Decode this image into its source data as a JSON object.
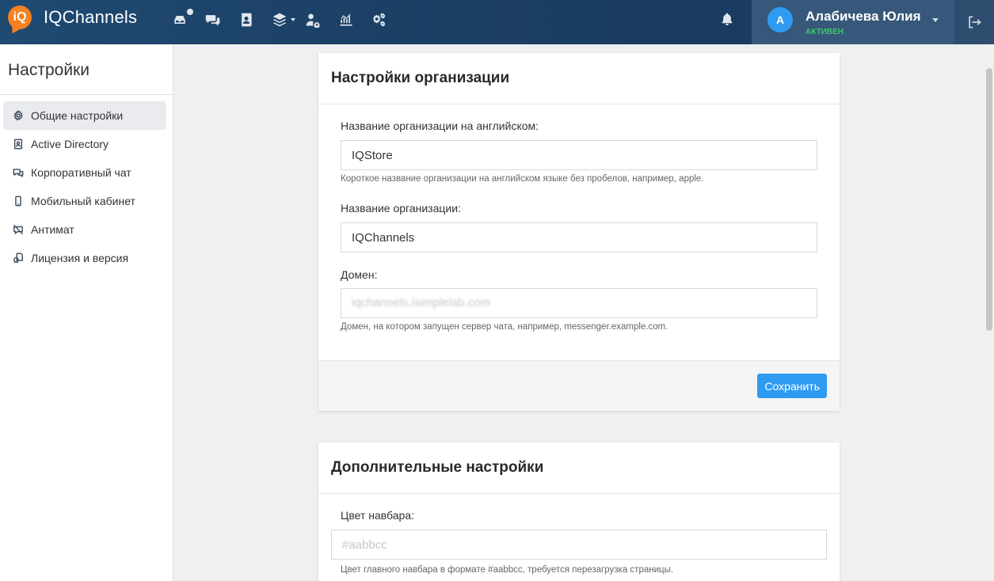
{
  "app": {
    "brand_logo": "iQ",
    "brand_name": "IQChannels"
  },
  "navbar": {
    "icons": [
      "inbox-icon",
      "chats-icon",
      "contacts-icon",
      "layers-icon",
      "users-settings-icon",
      "analytics-icon",
      "settings-icon"
    ],
    "bell_icon": "bell-icon",
    "user": {
      "avatar_initial": "А",
      "name": "Алабичева Юлия",
      "status": "АКТИВЕН"
    },
    "logout_icon": "logout-icon"
  },
  "colors": {
    "navbar": "#1f4a72",
    "user_panel": "#37587a",
    "accent": "#2e9bf2",
    "status_active": "#3ec66b",
    "brand_orange": "#f58220"
  },
  "sidebar": {
    "title": "Настройки",
    "items": [
      {
        "label": "Общие настройки",
        "icon": "gear-icon",
        "active": true
      },
      {
        "label": "Active Directory",
        "icon": "address-book-icon",
        "active": false
      },
      {
        "label": "Корпоративный чат",
        "icon": "chat-bubbles-icon",
        "active": false
      },
      {
        "label": "Мобильный кабинет",
        "icon": "mobile-icon",
        "active": false
      },
      {
        "label": "Антимат",
        "icon": "muted-comment-icon",
        "active": false
      },
      {
        "label": "Лицензия и версия",
        "icon": "license-icon",
        "active": false
      }
    ]
  },
  "org_settings": {
    "title": "Настройки организации",
    "english_name_label": "Название организации на английском:",
    "english_name_value": "IQStore",
    "english_name_help": "Короткое название организации на английском языке без пробелов, например, apple.",
    "org_name_label": "Название организации:",
    "org_name_value": "IQChannels",
    "domain_label": "Домен:",
    "domain_value": "iqchannels.isimplelab.com",
    "domain_help": "Домен, на котором запущен сервер чата, например, messenger.example.com.",
    "save_label": "Сохранить"
  },
  "extra_settings": {
    "title": "Дополнительные настройки",
    "navbar_color_label": "Цвет навбара:",
    "navbar_color_placeholder": "#aabbcc",
    "navbar_color_help": "Цвет главного навбара в формате #aabbcc, требуется перезагрузка страницы."
  }
}
